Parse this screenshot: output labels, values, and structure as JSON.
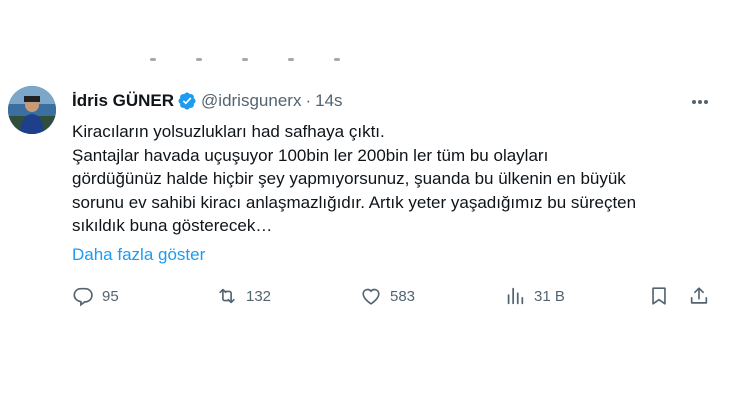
{
  "tweet": {
    "author_name": "İdris GÜNER",
    "handle": "@idrisgunerx",
    "separator": "·",
    "time": "14s",
    "lines": [
      "Kiracıların yolsuzlukları had safhaya çıktı.",
      "Şantajlar havada uçuşuyor 100bin ler 200bin ler tüm bu olayları",
      "gördüğünüz halde hiçbir şey yapmıyorsunuz, şuanda bu ülkenin en büyük",
      "sorunu ev sahibi kiracı anlaşmazlığıdır. Artık yeter yaşadığımız bu süreçten",
      "sıkıldık buna gösterecek…"
    ],
    "show_more": "Daha fazla göster"
  },
  "actions": {
    "replies": "95",
    "retweets": "132",
    "likes": "583",
    "views": "31 B"
  },
  "icons": [
    "verified-badge-icon",
    "more-options-icon",
    "reply-icon",
    "retweet-icon",
    "like-icon",
    "views-icon",
    "bookmark-icon",
    "share-icon"
  ],
  "colors": {
    "accent": "#1d9bf0",
    "muted": "#536471",
    "text": "#0f1419"
  }
}
